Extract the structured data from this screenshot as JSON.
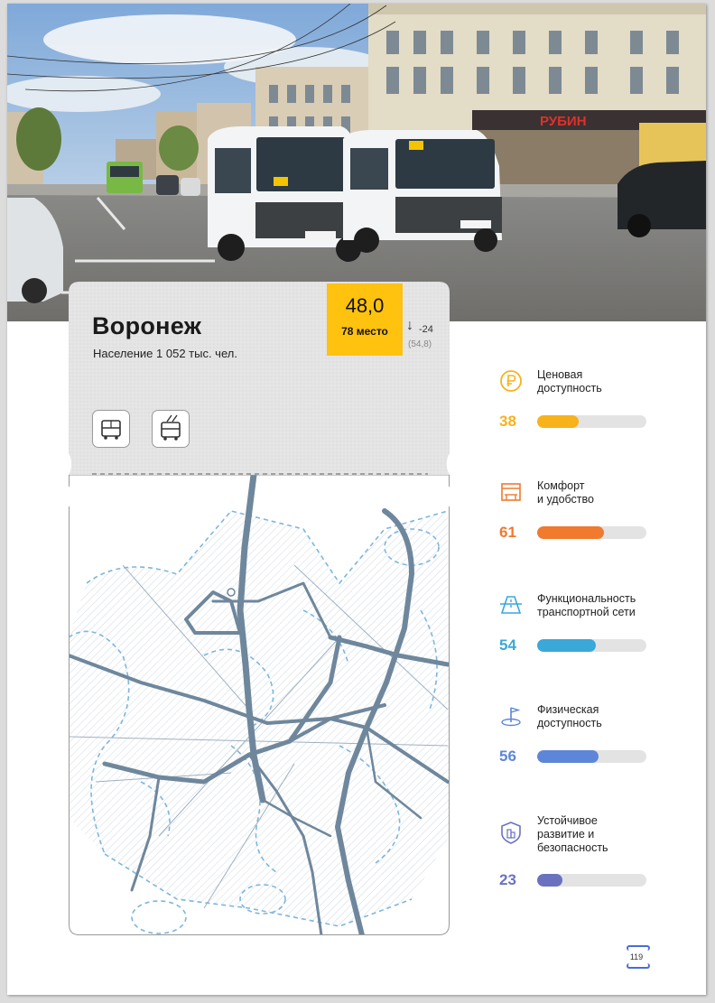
{
  "city": {
    "name": "Воронеж",
    "population": "Население 1 052 тыс. чел.",
    "score": "48,0",
    "rank": "78 место",
    "delta": "-24",
    "previous_score": "(54,8)",
    "transport_modes": [
      "bus-icon",
      "trolleybus-icon"
    ]
  },
  "photo": {
    "shop_sign": "РУБИН"
  },
  "metrics": [
    {
      "label_lines": [
        "Ценовая",
        "доступность"
      ],
      "value": "38",
      "fraction": 0.38,
      "color": "#f7b21c",
      "icon": "ruble-coin-icon"
    },
    {
      "label_lines": [
        "Комфорт",
        "и удобство"
      ],
      "value": "61",
      "fraction": 0.61,
      "color": "#f07a2e",
      "icon": "bus-stop-icon"
    },
    {
      "label_lines": [
        "Функциональность",
        "транспортной сети"
      ],
      "value": "54",
      "fraction": 0.54,
      "color": "#3aa8d8",
      "icon": "road-network-icon"
    },
    {
      "label_lines": [
        "Физическая",
        "доступность"
      ],
      "value": "56",
      "fraction": 0.56,
      "color": "#5e86d8",
      "icon": "location-flag-icon"
    },
    {
      "label_lines": [
        "Устойчивое",
        "развитие и",
        "безопасность"
      ],
      "value": "23",
      "fraction": 0.23,
      "color": "#6a72c0",
      "icon": "shield-city-icon"
    }
  ],
  "page_number": "119"
}
